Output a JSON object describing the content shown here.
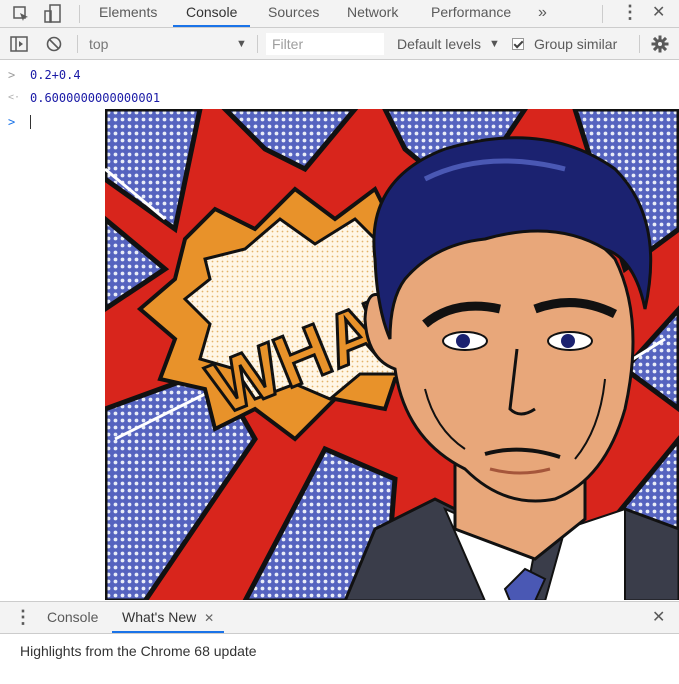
{
  "topbar": {
    "tabs": [
      "Elements",
      "Console",
      "Sources",
      "Network",
      "Performance"
    ],
    "active_tab": "Console",
    "more_label": "»",
    "menu_label": "⋮",
    "close_label": "✕"
  },
  "toolbar": {
    "context": "top",
    "filter_placeholder": "Filter",
    "levels": "Default levels",
    "levels_arrow": "▼",
    "context_arrow": "▼",
    "group_similar": "Group similar",
    "group_similar_checked": true
  },
  "console": {
    "lines": [
      {
        "prompt": ">",
        "text": "0.2+0.4"
      },
      {
        "prompt": "<·",
        "text": "0.6000000000000001"
      }
    ],
    "input_prompt": ">",
    "artwork_text": "WHAT?"
  },
  "drawer": {
    "tabs": [
      "Console",
      "What's New"
    ],
    "active": "What's New",
    "tab_close": "✕",
    "close_label": "✕",
    "highlights": "Highlights from the Chrome 68 update"
  },
  "colors": {
    "accent": "#1a73e8",
    "red": "#d8251c",
    "blue": "#4a58b4",
    "orange": "#e8922a",
    "hair": "#1b2270",
    "skin": "#e8a77a"
  }
}
